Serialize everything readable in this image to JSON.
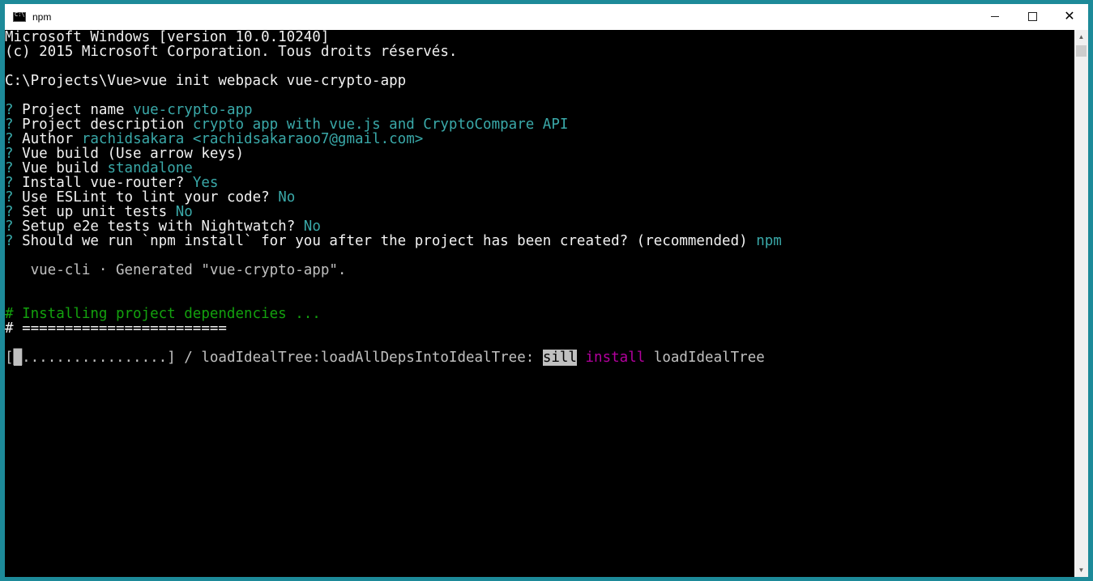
{
  "window": {
    "title": "npm",
    "minimize_label": "",
    "maximize_label": "",
    "close_label": "✕"
  },
  "console": {
    "l1": "Microsoft Windows [version 10.0.10240]",
    "l2": "(c) 2015 Microsoft Corporation. Tous droits réservés.",
    "l3": "C:\\Projects\\Vue>vue init webpack vue-crypto-app",
    "q_mark": "?",
    "prompts": [
      {
        "label": "Project name",
        "answer": "vue-crypto-app"
      },
      {
        "label": "Project description",
        "answer": "crypto app with vue.js and CryptoCompare API"
      },
      {
        "label": "Author",
        "answer": "rachidsakara <rachidsakaraoo7@gmail.com>"
      },
      {
        "label": "Vue build (Use arrow keys)",
        "answer": ""
      },
      {
        "label": "Vue build",
        "answer": "standalone"
      },
      {
        "label": "Install vue-router?",
        "answer": "Yes"
      },
      {
        "label": "Use ESLint to lint your code?",
        "answer": "No"
      },
      {
        "label": "Set up unit tests",
        "answer": "No"
      },
      {
        "label": "Setup e2e tests with Nightwatch?",
        "answer": "No"
      },
      {
        "label": "Should we run `npm install` for you after the project has been created? (recommended)",
        "answer": "npm"
      }
    ],
    "generated": "   vue-cli · Generated \"vue-crypto-app\".",
    "installing": "# Installing project dependencies ...",
    "separator": "# ========================",
    "progress_open": "[",
    "progress_dots": ".................",
    "progress_rest": "] / loadIdealTree:loadAllDepsIntoIdealTree: ",
    "sill": "sill",
    "install": "install",
    "load_tree": "loadIdealTree"
  },
  "colors": {
    "console_bg": "#000000",
    "text": "#c0c0c0",
    "answer": "#3aa9a9",
    "green": "#13a10e",
    "magenta": "#b4009e"
  }
}
